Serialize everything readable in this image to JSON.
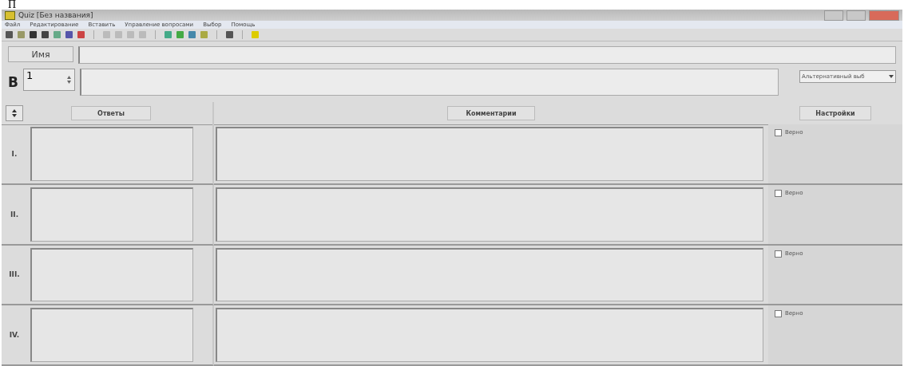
{
  "page_text": "П",
  "window": {
    "title": "Quiz [Без названия]"
  },
  "menu": [
    "Файл",
    "Редактирование",
    "Вставить",
    "Управление вопросами",
    "Выбор",
    "Помощь"
  ],
  "name_row": {
    "label": "Имя"
  },
  "question_row": {
    "label": "B",
    "number": "1",
    "type": "Альтернативный выб"
  },
  "headers": {
    "answers": "Ответы",
    "comments": "Комментарии",
    "settings": "Настройки"
  },
  "rows": [
    {
      "label": "I.",
      "checkbox_label": "Верно",
      "checked": false
    },
    {
      "label": "II.",
      "checkbox_label": "Верно",
      "checked": false
    },
    {
      "label": "III.",
      "checkbox_label": "Верно",
      "checked": false
    },
    {
      "label": "IV.",
      "checkbox_label": "Верно",
      "checked": false
    }
  ]
}
